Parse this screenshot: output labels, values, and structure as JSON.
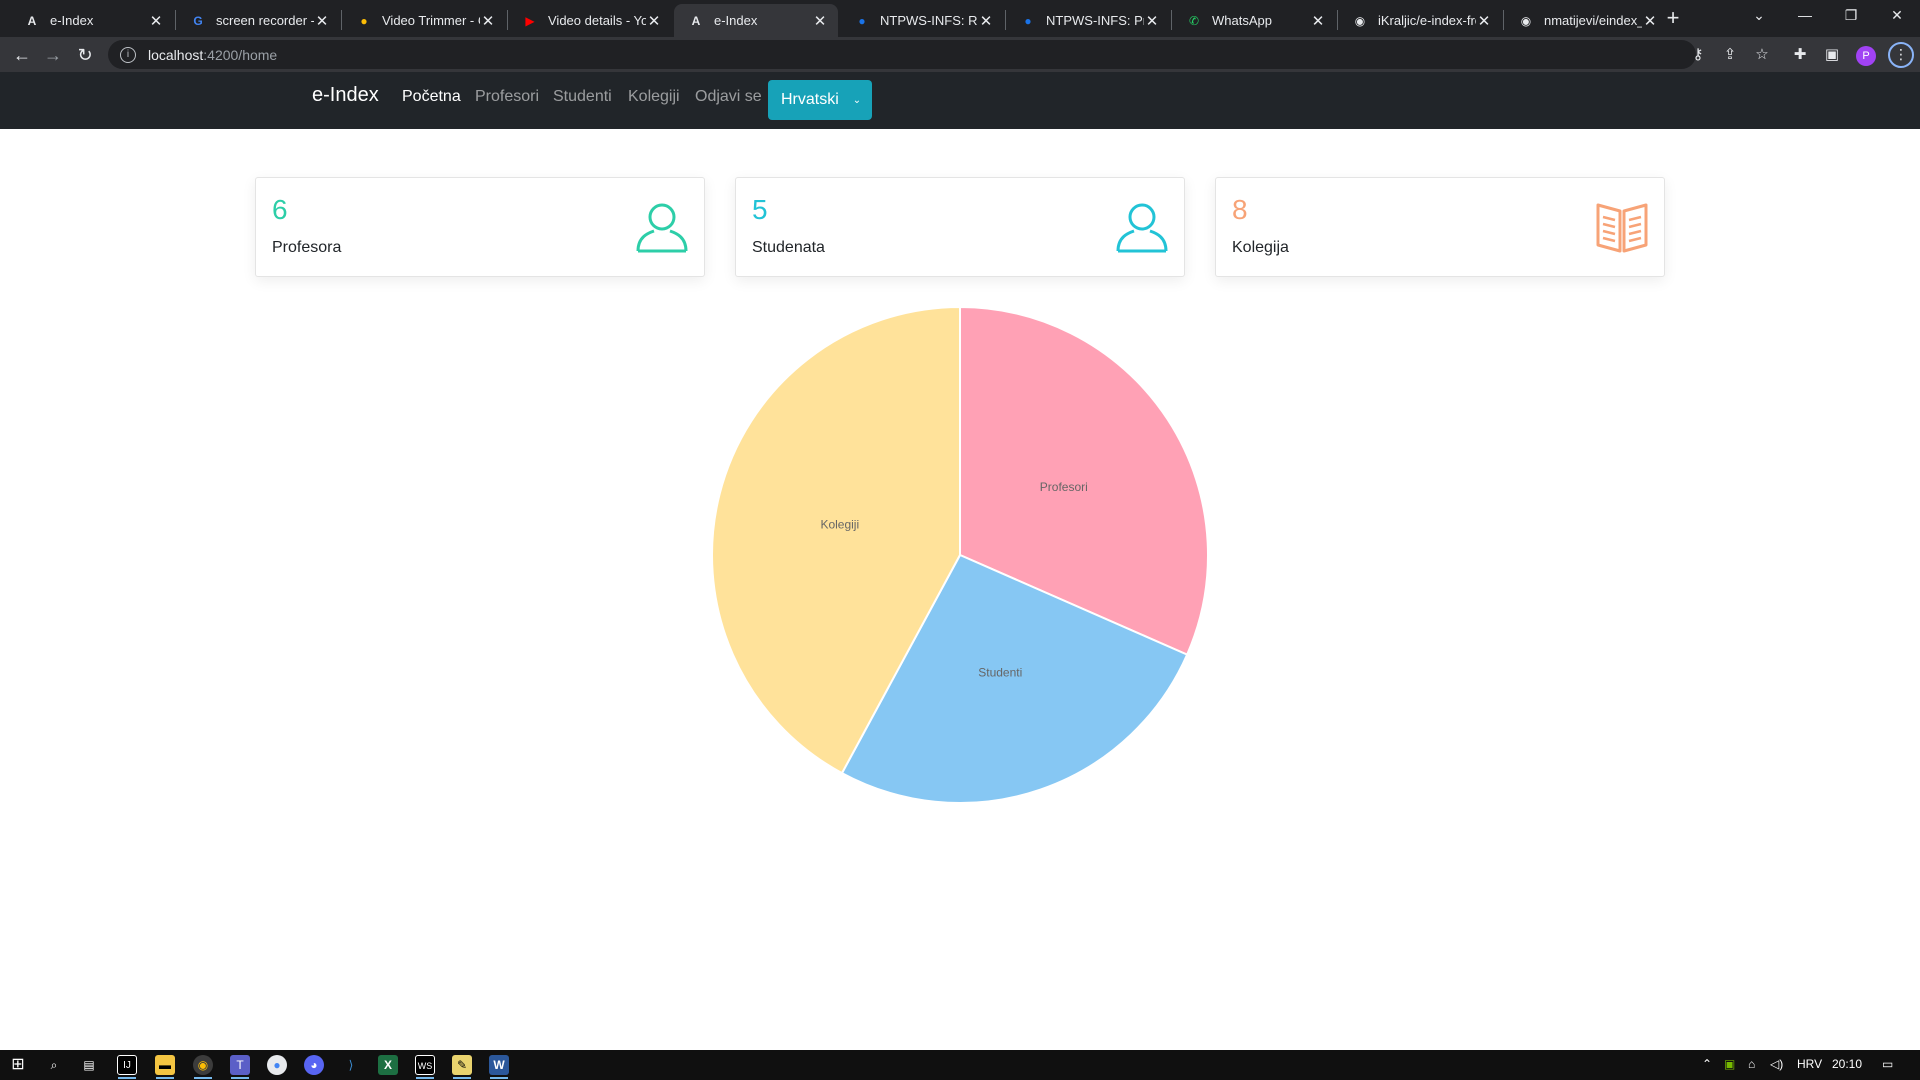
{
  "browser": {
    "tabs": [
      {
        "title": "e-Index",
        "icon": "angular-icon",
        "active": false
      },
      {
        "title": "screen recorder - G",
        "icon": "google-icon",
        "active": false
      },
      {
        "title": "Video Trimmer - Cu",
        "icon": "video-trimmer-icon",
        "active": false
      },
      {
        "title": "Video details - You",
        "icon": "youtube-icon",
        "active": false
      },
      {
        "title": "e-Index",
        "icon": "angular-icon",
        "active": true
      },
      {
        "title": "NTPWS-INFS: Rasp",
        "icon": "globe-icon",
        "active": false
      },
      {
        "title": "NTPWS-INFS: Pred",
        "icon": "globe-icon",
        "active": false
      },
      {
        "title": "WhatsApp",
        "icon": "whatsapp-icon",
        "active": false
      },
      {
        "title": "iKraljic/e-index-fro",
        "icon": "github-icon",
        "active": false
      },
      {
        "title": "nmatijevi/eindex_b",
        "icon": "github-icon",
        "active": false
      }
    ],
    "address": {
      "host": "localhost",
      "path": ":4200/home"
    },
    "profile_initial": "P"
  },
  "nav": {
    "brand": "e-Index",
    "links": [
      "Početna",
      "Profesori",
      "Studenti",
      "Kolegiji",
      "Odjavi se"
    ],
    "active_link": "Početna",
    "language": "Hrvatski"
  },
  "stats": [
    {
      "value": "6",
      "label": "Profesora",
      "icon": "user-icon",
      "color": "#2dcea8"
    },
    {
      "value": "5",
      "label": "Studenata",
      "icon": "user-icon",
      "color": "#22c3d6"
    },
    {
      "value": "8",
      "label": "Kolegija",
      "icon": "book-icon",
      "color": "#f7a377"
    }
  ],
  "chart_data": {
    "type": "pie",
    "title": "",
    "categories": [
      "Profesori",
      "Studenti",
      "Kolegiji"
    ],
    "values": [
      6,
      5,
      8
    ],
    "colors": [
      "#ffa1b5",
      "#86c7f3",
      "#ffe29a"
    ],
    "legend": "none"
  },
  "taskbar": {
    "language": "HRV",
    "time": "20:10"
  }
}
